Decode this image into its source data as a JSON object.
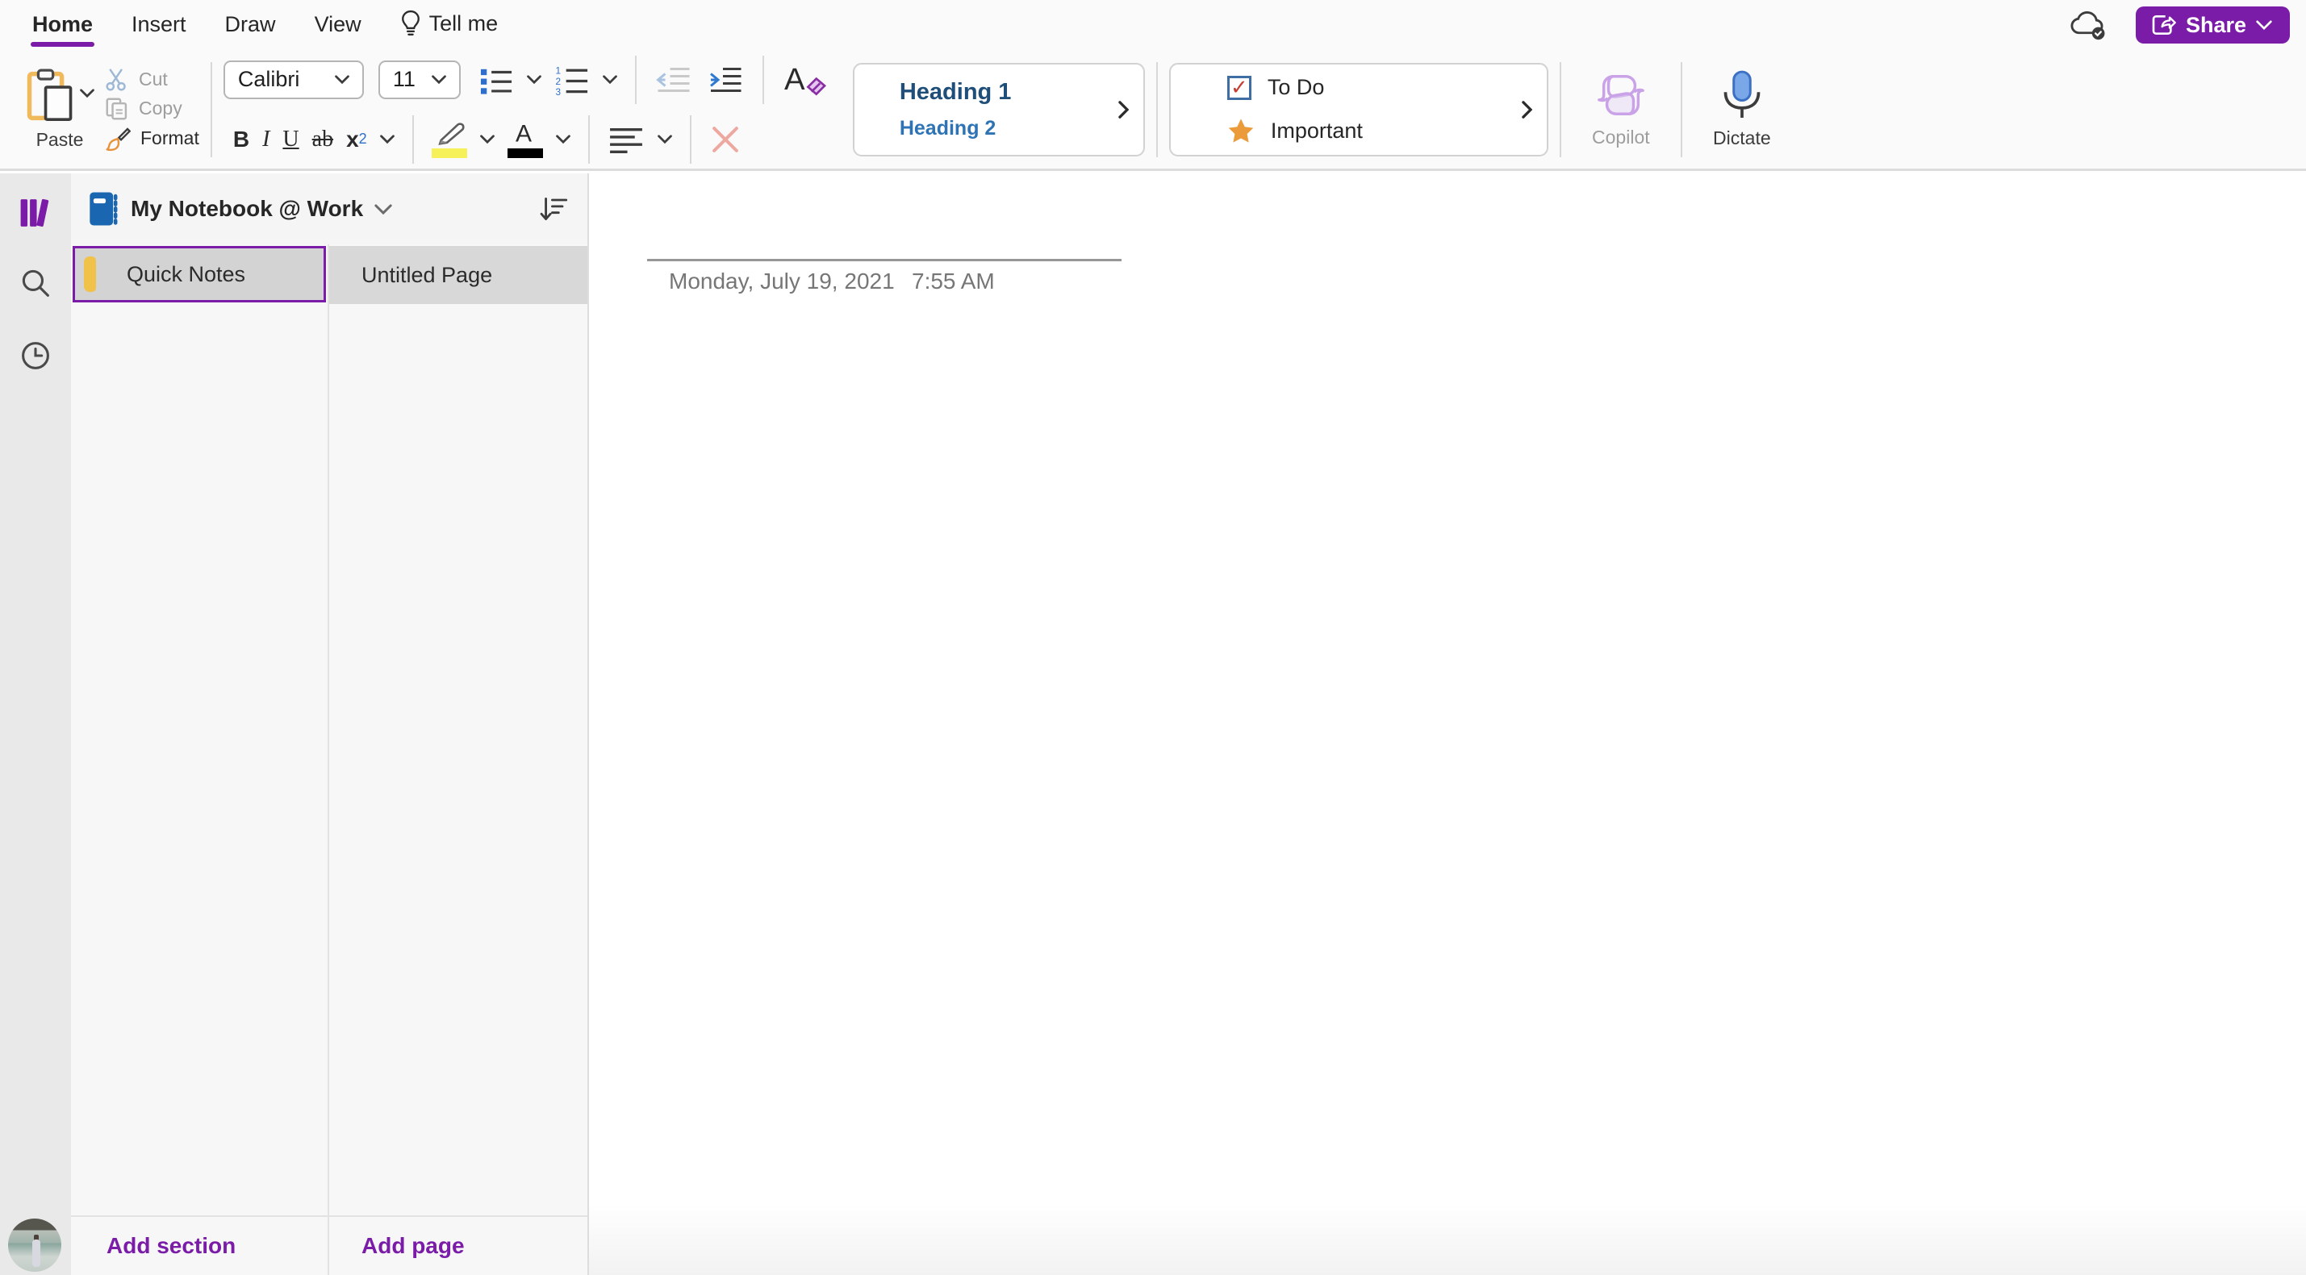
{
  "menu": {
    "home": "Home",
    "insert": "Insert",
    "draw": "Draw",
    "view": "View",
    "tellme": "Tell me"
  },
  "titlebar": {
    "share": "Share"
  },
  "ribbon": {
    "paste": "Paste",
    "cut": "Cut",
    "copy": "Copy",
    "format": "Format",
    "font_name": "Calibri",
    "font_size": "11",
    "bold": "B",
    "italic": "I",
    "underline": "U",
    "strikethrough": "ab",
    "subscript_base": "x",
    "subscript_sub": "2",
    "heading1": "Heading 1",
    "heading2": "Heading 2",
    "todo": "To Do",
    "important": "Important",
    "copilot": "Copilot",
    "dictate": "Dictate"
  },
  "nav": {
    "notebook_title": "My Notebook @ Work",
    "sections": [
      {
        "name": "Quick Notes",
        "selected": true
      }
    ],
    "pages": [
      {
        "name": "Untitled Page",
        "selected": true
      }
    ],
    "add_section": "Add section",
    "add_page": "Add page"
  },
  "page": {
    "date": "Monday, July 19, 2021",
    "time": "7:55 AM"
  },
  "colors": {
    "accent": "#7a1ca8",
    "heading1": "#1f4e79",
    "heading2": "#2e74b5",
    "todo_check": "#c43e33",
    "star": "#ec9b3b",
    "section_tab": "#f0c24a",
    "highlight": "#f7f159",
    "font_color_bar": "#000000",
    "notebook_icon": "#1a66b0",
    "dictate_mic": "#79a7e8",
    "copilot_icon": "#c9a2e8",
    "selected_row_bg": "#d3d3d3"
  }
}
